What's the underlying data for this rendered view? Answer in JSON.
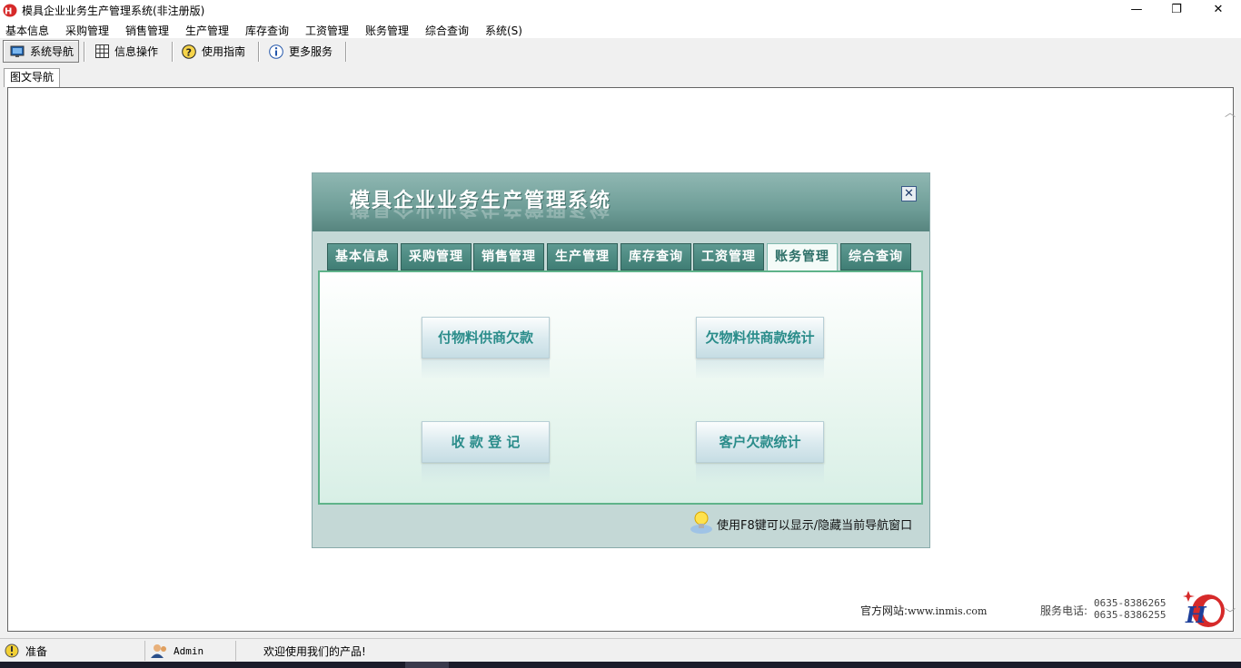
{
  "window": {
    "title": "模具企业业务生产管理系统(非注册版)",
    "controls": {
      "minimize": "—",
      "restore": "❐",
      "close": "✕"
    }
  },
  "menu": [
    "基本信息",
    "采购管理",
    "销售管理",
    "生产管理",
    "库存查询",
    "工资管理",
    "账务管理",
    "综合查询",
    "系统(S)"
  ],
  "toolbar": {
    "items": [
      {
        "label": "系统导航",
        "icon": "monitor-icon",
        "active": true
      },
      {
        "label": "信息操作",
        "icon": "grid-icon",
        "active": false
      },
      {
        "label": "使用指南",
        "icon": "help-icon",
        "active": false
      },
      {
        "label": "更多服务",
        "icon": "info-icon",
        "active": false
      }
    ]
  },
  "doc_tab": {
    "label": "图文导航"
  },
  "dialog": {
    "title": "模具企业业务生产管理系统",
    "close_symbol": "✕",
    "tabs": [
      "基本信息",
      "采购管理",
      "销售管理",
      "生产管理",
      "库存查询",
      "工资管理",
      "账务管理",
      "综合查询"
    ],
    "selected_tab": "账务管理",
    "buttons": [
      "付物料供商欠款",
      "欠物料供商款统计",
      "收 款 登 记",
      "客户欠款统计"
    ],
    "hint": "使用F8键可以显示/隐藏当前导航窗口"
  },
  "footer": {
    "site_label": "官方网站:",
    "site_url": "www.inmis.com",
    "phone_label": "服务电话:",
    "phones": [
      "0635-8386265",
      "0635-8386255"
    ]
  },
  "status": {
    "state": "准备",
    "user": "Admin",
    "message": "欢迎使用我们的产品!"
  },
  "colors": {
    "dialog_header": "#6f9e98",
    "tab_bg": "#3f7d74",
    "button_text": "#2a8c8a",
    "panel_border": "#5fb38a"
  }
}
